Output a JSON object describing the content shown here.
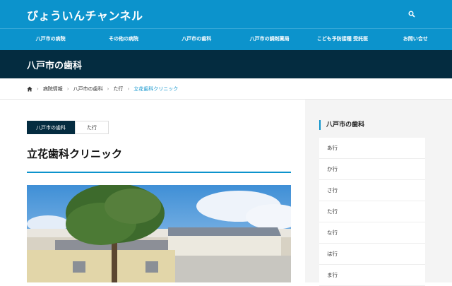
{
  "header": {
    "logo": "びょういんチャンネル"
  },
  "nav": [
    "八戸市の病院",
    "その他の病院",
    "八戸市の歯科",
    "八戸市の調剤薬局",
    "こども予防接種 受託医",
    "お問い合せ"
  ],
  "page_title": "八戸市の歯科",
  "breadcrumb": [
    "病院情報",
    "八戸市の歯科",
    "た行",
    "立花歯科クリニック"
  ],
  "tags": [
    "八戸市の歯科",
    "た行"
  ],
  "article_title": "立花歯科クリニック",
  "sidebar": {
    "heading": "八戸市の歯科",
    "items": [
      "あ行",
      "か行",
      "さ行",
      "た行",
      "な行",
      "は行",
      "ま行"
    ]
  },
  "colors": {
    "primary": "#0c93cc",
    "dark": "#042c40"
  }
}
